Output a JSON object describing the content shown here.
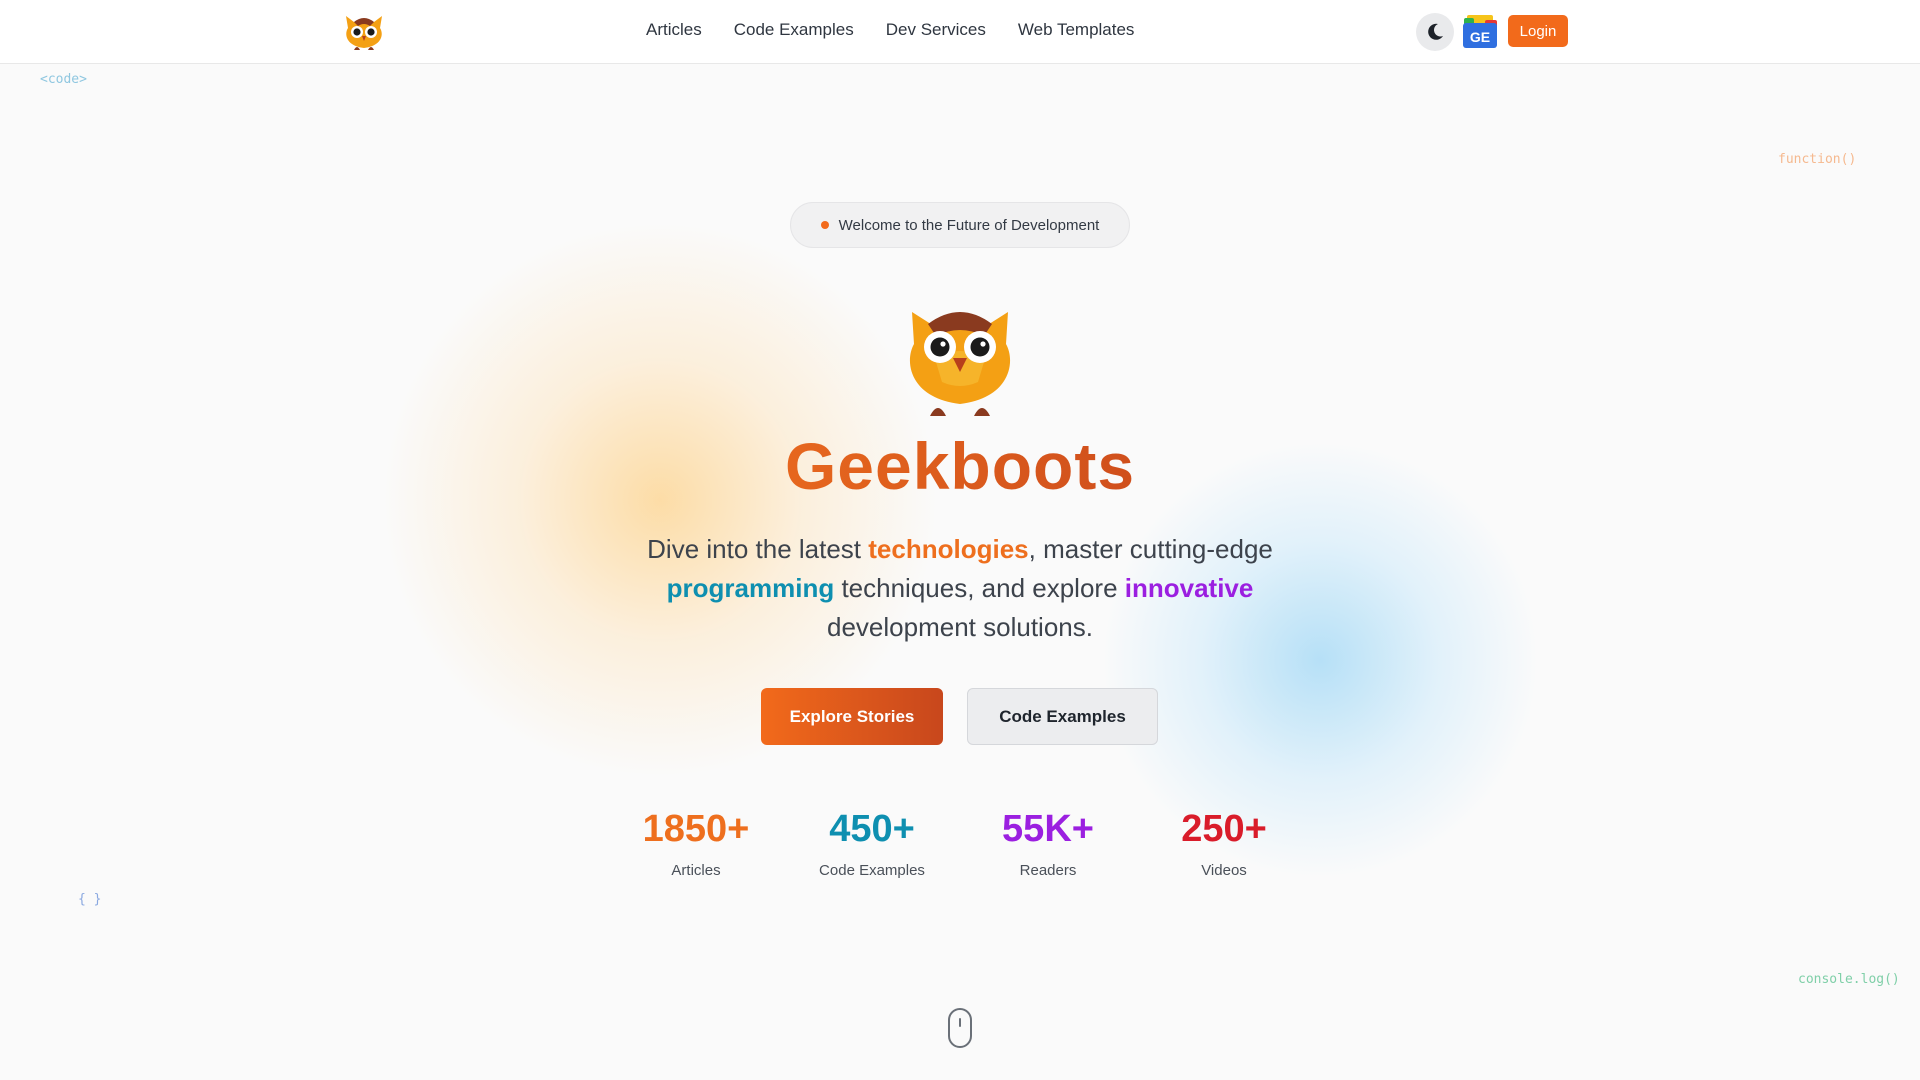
{
  "header": {
    "nav": [
      {
        "label": "Articles"
      },
      {
        "label": "Code Examples"
      },
      {
        "label": "Dev Services"
      },
      {
        "label": "Web Templates"
      }
    ],
    "login_label": "Login",
    "ge_badge": "GE"
  },
  "decor": {
    "code_tag": "<code>",
    "function_tag": "function()",
    "braces_tag": "{ }",
    "console_tag": "console.log()"
  },
  "hero": {
    "pill_text": "Welcome to the Future of Development",
    "brand": "Geekboots",
    "tagline": {
      "part1": "Dive into the latest ",
      "hl1": "technologies",
      "part2": ", master cutting-edge ",
      "hl2": "programming",
      "part3": " techniques, and explore ",
      "hl3": "innovative",
      "part4": " development solutions."
    },
    "primary_button": "Explore Stories",
    "secondary_button": "Code Examples"
  },
  "stats": [
    {
      "value": "1850+",
      "label": "Articles",
      "color": "#ee6f1e"
    },
    {
      "value": "450+",
      "label": "Code Examples",
      "color": "#0e8fb0"
    },
    {
      "value": "55K+",
      "label": "Readers",
      "color": "#9b1fe0"
    },
    {
      "value": "250+",
      "label": "Videos",
      "color": "#d91c2a"
    }
  ],
  "colors": {
    "accent": "#f26a1b",
    "brand_gradient_end": "#c8471c"
  },
  "icons": {
    "logo": "owl-logo-icon",
    "theme": "moon-icon",
    "scroll": "mouse-scroll-icon"
  }
}
